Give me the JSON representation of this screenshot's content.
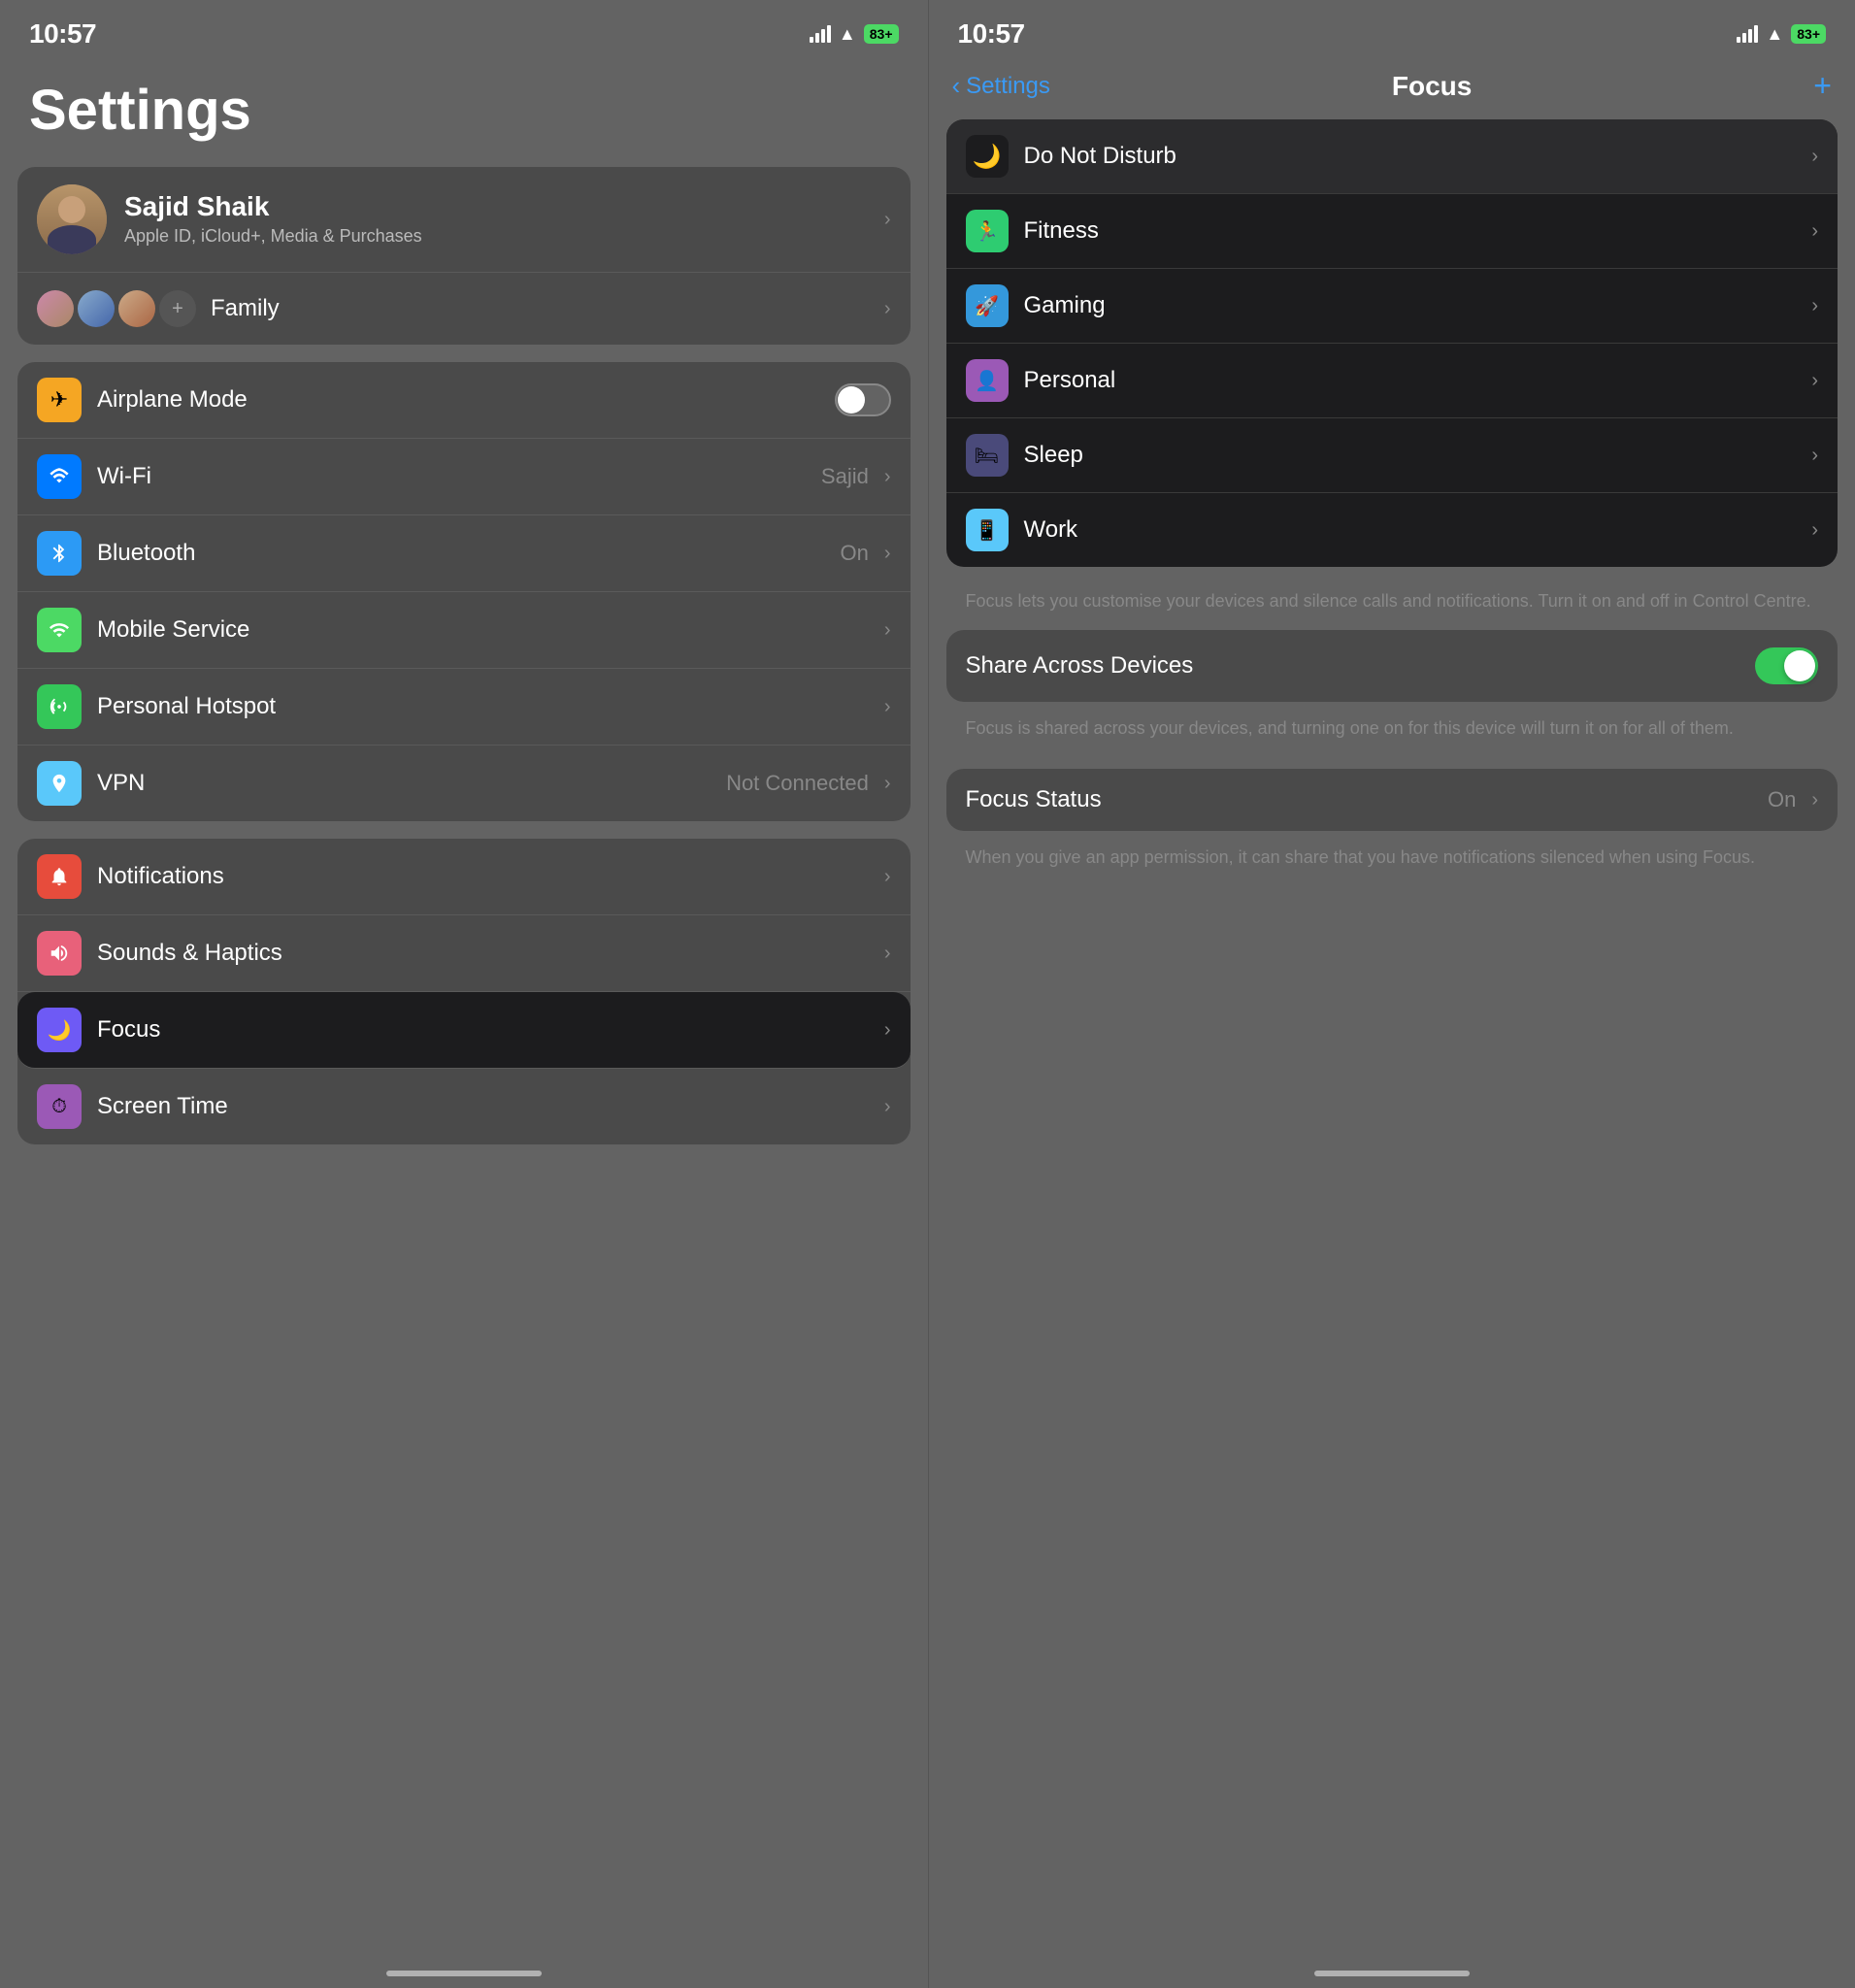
{
  "left": {
    "statusBar": {
      "time": "10:57",
      "battery": "83+"
    },
    "title": "Settings",
    "profile": {
      "name": "Sajid Shaik",
      "subtitle": "Apple ID, iCloud+, Media\n& Purchases"
    },
    "family": {
      "label": "Family"
    },
    "sections": [
      {
        "rows": [
          {
            "icon": "✈",
            "iconColor": "icon-orange",
            "label": "Airplane Mode",
            "value": "",
            "showToggle": true,
            "chevron": false
          },
          {
            "icon": "📶",
            "iconColor": "icon-blue",
            "label": "Wi-Fi",
            "value": "Sajid",
            "showToggle": false,
            "chevron": true
          },
          {
            "icon": "∗",
            "iconColor": "icon-blue-mid",
            "label": "Bluetooth",
            "value": "On",
            "showToggle": false,
            "chevron": true
          },
          {
            "icon": "●",
            "iconColor": "icon-green",
            "label": "Mobile Service",
            "value": "",
            "showToggle": false,
            "chevron": true
          },
          {
            "icon": "⟳",
            "iconColor": "icon-green-mid",
            "label": "Personal Hotspot",
            "value": "",
            "showToggle": false,
            "chevron": true
          },
          {
            "icon": "🌐",
            "iconColor": "icon-teal",
            "label": "VPN",
            "value": "Not Connected",
            "showToggle": false,
            "chevron": true
          }
        ]
      },
      {
        "rows": [
          {
            "icon": "🔔",
            "iconColor": "icon-red",
            "label": "Notifications",
            "value": "",
            "showToggle": false,
            "chevron": true
          },
          {
            "icon": "🔊",
            "iconColor": "icon-pink",
            "label": "Sounds & Haptics",
            "value": "",
            "showToggle": false,
            "chevron": true
          },
          {
            "icon": "🌙",
            "iconColor": "icon-purple",
            "label": "Focus",
            "value": "",
            "showToggle": false,
            "chevron": true,
            "selected": true
          },
          {
            "icon": "⏱",
            "iconColor": "icon-purple-light",
            "label": "Screen Time",
            "value": "",
            "showToggle": false,
            "chevron": true
          }
        ]
      }
    ]
  },
  "right": {
    "statusBar": {
      "time": "10:57",
      "battery": "83+"
    },
    "nav": {
      "backLabel": "Settings",
      "title": "Focus",
      "addLabel": "+"
    },
    "focusItems": [
      {
        "icon": "🌙",
        "iconBg": "dnd",
        "label": "Do Not Disturb",
        "selected": true
      },
      {
        "icon": "🏃",
        "iconBg": "fitness",
        "label": "Fitness"
      },
      {
        "icon": "🚀",
        "iconBg": "gaming",
        "label": "Gaming"
      },
      {
        "icon": "👤",
        "iconBg": "personal",
        "label": "Personal"
      },
      {
        "icon": "🛏",
        "iconBg": "sleep",
        "label": "Sleep"
      },
      {
        "icon": "📱",
        "iconBg": "work",
        "label": "Work"
      }
    ],
    "focusDescription": "Focus lets you customise your devices and silence calls and notifications. Turn it on and off in Control Centre.",
    "shareAcrossDevices": {
      "label": "Share Across Devices",
      "enabled": true,
      "description": "Focus is shared across your devices, and turning one on for this device will turn it on for all of them."
    },
    "focusStatus": {
      "label": "Focus Status",
      "value": "On",
      "description": "When you give an app permission, it can share that you have notifications silenced when using Focus."
    }
  }
}
